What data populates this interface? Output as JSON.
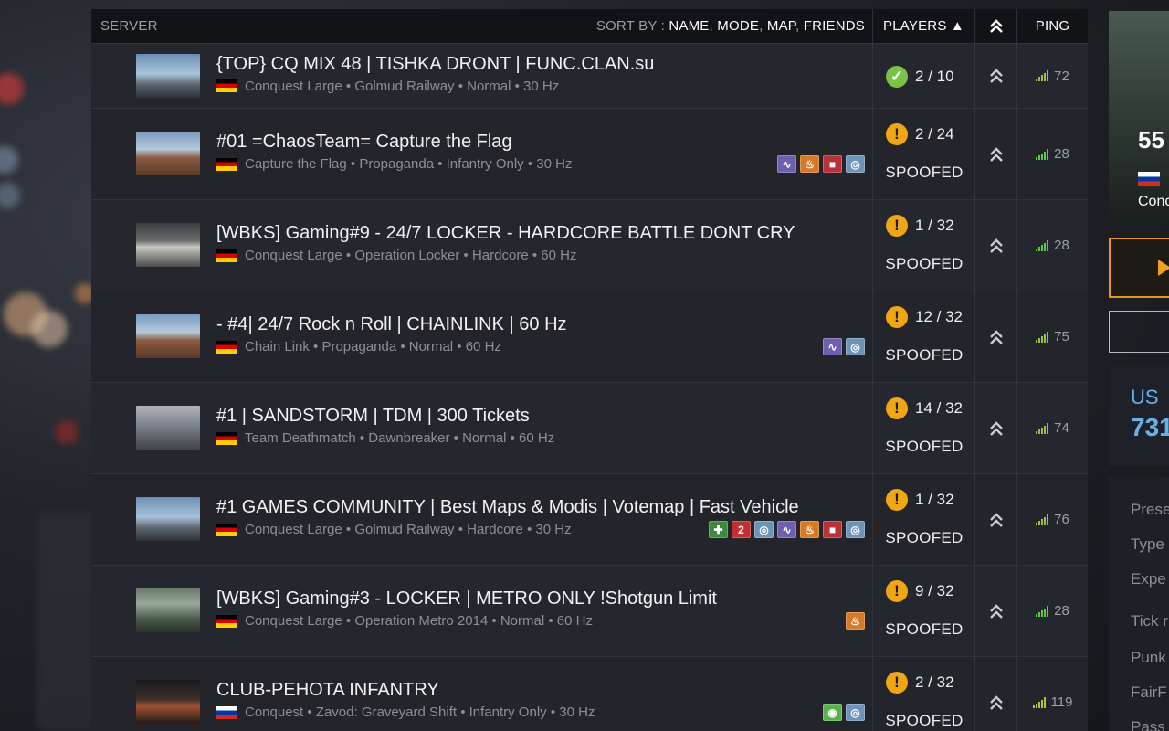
{
  "header": {
    "server_label": "SERVER",
    "sort_prefix": "SORT BY :",
    "sort_name": "NAME",
    "sort_mode": "MODE",
    "sort_map": "MAP",
    "sort_friends": "FRIENDS",
    "players_label": "PLAYERS ▲",
    "ping_label": "PING"
  },
  "servers": [
    {
      "name": "{TOP} CQ MIX 48 | TISHKA DRONT | FUNC.CLAN.su",
      "info": "Conquest Large • Golmud Railway • Normal • 30 Hz",
      "flag": "DE",
      "players": "2 / 10",
      "status": "ok",
      "spoofed": "",
      "ping": "72",
      "badges": []
    },
    {
      "name": "#01 =ChaosTeam= Capture the Flag",
      "info": "Capture the Flag • Propaganda • Infantry Only • 30 Hz",
      "flag": "DE",
      "players": "2 / 24",
      "status": "warn",
      "spoofed": "SPOOFED",
      "ping": "28",
      "badges": [
        "purple",
        "orange",
        "red",
        "blue"
      ]
    },
    {
      "name": "[WBKS] Gaming#9 - 24/7 LOCKER - HARDCORE BATTLE DONT CRY",
      "info": "Conquest Large • Operation Locker • Hardcore • 60 Hz",
      "flag": "DE",
      "players": "1 / 32",
      "status": "warn",
      "spoofed": "SPOOFED",
      "ping": "28",
      "badges": []
    },
    {
      "name": "- #4| 24/7 Rock n Roll | CHAINLINK | 60 Hz",
      "info": "Chain Link • Propaganda • Normal • 60 Hz",
      "flag": "DE",
      "players": "12 / 32",
      "status": "warn",
      "spoofed": "SPOOFED",
      "ping": "75",
      "badges": [
        "purple",
        "blue"
      ]
    },
    {
      "name": "#1 | SANDSTORM | TDM | 300 Tickets",
      "info": "Team Deathmatch • Dawnbreaker • Normal • 60 Hz",
      "flag": "DE",
      "players": "14 / 32",
      "status": "warn",
      "spoofed": "SPOOFED",
      "ping": "74",
      "badges": []
    },
    {
      "name": "#1 GAMES COMMUNITY | Best Maps & Modis | Votemap | Fast Vehicle",
      "info": "Conquest Large • Golmud Railway • Hardcore • 30 Hz",
      "flag": "DE",
      "players": "1 / 32",
      "status": "warn",
      "spoofed": "SPOOFED",
      "ping": "76",
      "badges": [
        "green",
        "darkred",
        "blue",
        "purple",
        "orange",
        "red",
        "blue"
      ]
    },
    {
      "name": "[WBKS] Gaming#3 - LOCKER | METRO ONLY !Shotgun Limit",
      "info": "Conquest Large • Operation Metro 2014 • Normal • 60 Hz",
      "flag": "DE",
      "players": "9 / 32",
      "status": "warn",
      "spoofed": "SPOOFED",
      "ping": "28",
      "badges": [
        "orange"
      ]
    },
    {
      "name": "CLUB-PEHOTA INFANTRY",
      "info": "Conquest • Zavod: Graveyard Shift • Infantry Only • 30 Hz",
      "flag": "RU",
      "players": "2 / 32",
      "status": "warn",
      "spoofed": "SPOOFED",
      "ping": "119",
      "badges": [
        "lgreen",
        "blue"
      ]
    }
  ],
  "badge_glyphs": {
    "purple": "∿",
    "orange": "♨",
    "red": "■",
    "blue": "◎",
    "green": "✚",
    "darkred": "2",
    "lgreen": "◉"
  },
  "right_panel": {
    "players_num": "55",
    "mode_text": "Conc",
    "stat_label": "US",
    "stat_value": "731",
    "info_items": [
      "Prese",
      "Type",
      "Expe",
      "Tick r",
      "Punk",
      "FairF",
      "Pass"
    ]
  }
}
